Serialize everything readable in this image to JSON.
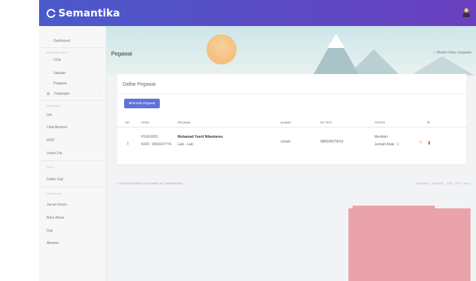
{
  "app": {
    "brand": "Semantika"
  },
  "sidebar": {
    "dashboard": "Dashboard",
    "master_head": "MASTER DATA",
    "coa": "COA",
    "jabatan": "Jabatan",
    "pegawai": "Pegawai",
    "tunjangan": "Tunjangan",
    "absensi_head": "ABSENSI",
    "izin": "Izin",
    "lihat_absensi": "Lihat Absensi",
    "rfid": "RFID",
    "undur_diri": "Undur Diri",
    "gaji_head": "GAJI",
    "daftar_gaji": "Daftar Gaji",
    "laporan_head": "LAPORAN",
    "jurnal_umum": "Jurnal Umum",
    "buku_besar": "Buku Besar",
    "gaji": "Gaji",
    "absensi": "Absensi"
  },
  "page": {
    "title": "Pegawai",
    "breadcrumb": "⌂  Master Data  /  pegawai"
  },
  "card": {
    "title": "Daftar Pegawai",
    "add_button": "✚Tambah Pegawai",
    "headers": [
      "NO",
      "KODE",
      "PEGAWAI",
      "ALAMAT",
      "NO TELP",
      "STATUS",
      "⚙"
    ],
    "row": {
      "no": "1",
      "kode": "PGW-0001",
      "rfid": "RFID : 0004247774",
      "nama": "Muhamad Yusril Nikaskeres",
      "jk": "Laki - Laki",
      "alamat": "cimahi",
      "telp": "089505975819",
      "status": "Menikah",
      "anak": "Jumlah Anak : 1"
    }
  },
  "footer": {
    "left": "© 2019 FRISTABLE V1.0.0 MADE BY LABORACION",
    "right": "LICENSES  CHANGE LOG  GET HELP"
  },
  "icons": {
    "edit": "pencil-icon",
    "delete": "trash-icon",
    "user": "user-avatar-icon"
  },
  "colors": {
    "topbar": "#4a5acb",
    "button": "#5f73d9",
    "delete": "#e04a4a",
    "edit": "#e0b020"
  }
}
